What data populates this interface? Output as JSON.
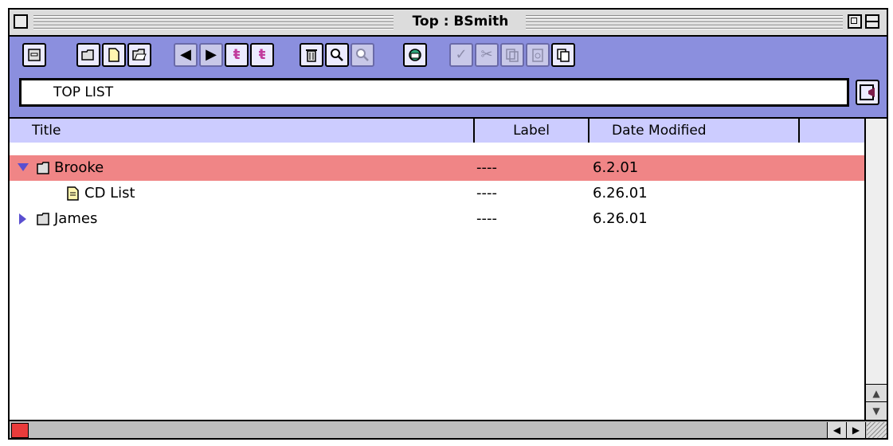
{
  "window": {
    "title": "Top : BSmith"
  },
  "path": {
    "value": "TOP LIST"
  },
  "columns": {
    "title": "Title",
    "label": "Label",
    "date_modified": "Date Modified"
  },
  "rows": [
    {
      "name": "Brooke",
      "label": "----",
      "date": "6.2.01",
      "type": "folder",
      "expanded": true,
      "selected": true,
      "indent": 0
    },
    {
      "name": "CD List",
      "label": "----",
      "date": "6.26.01",
      "type": "document",
      "expanded": false,
      "selected": false,
      "indent": 1
    },
    {
      "name": "James",
      "label": "----",
      "date": "6.26.01",
      "type": "folder",
      "expanded": false,
      "selected": false,
      "indent": 0
    }
  ],
  "icons": {
    "toolbar": [
      "drawer-icon",
      "folder-icon",
      "document-icon",
      "open-folder-icon",
      "back-arrow-icon",
      "forward-arrow-icon",
      "up-top-icon",
      "up-level-icon",
      "trash-icon",
      "find-icon",
      "find-again-icon",
      "sync-icon",
      "checkmark-icon",
      "scissors-icon",
      "copy-icon",
      "paste-icon",
      "duplicate-icon"
    ]
  },
  "colors": {
    "toolbar_bg": "#8b8fde",
    "header_bg": "#ccccff",
    "selection": "#f08586",
    "disclosure": "#5a4fd0"
  }
}
